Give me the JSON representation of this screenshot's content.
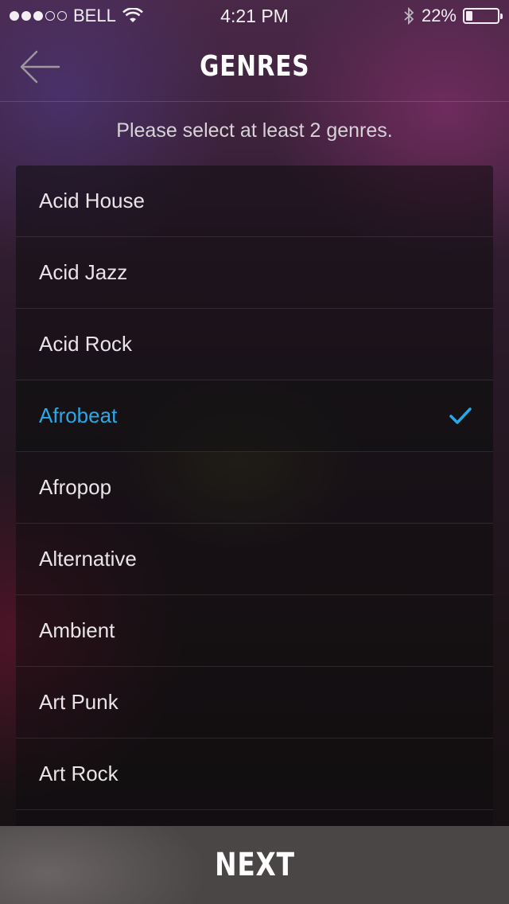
{
  "status_bar": {
    "carrier": "BELL",
    "time": "4:21 PM",
    "battery_text": "22%",
    "battery_level": 0.22,
    "signal_bars": 3,
    "signal_total": 5
  },
  "nav": {
    "title": "GENRES"
  },
  "instructions": "Please select at least 2 genres.",
  "genres": [
    {
      "label": "Acid House",
      "selected": false
    },
    {
      "label": "Acid Jazz",
      "selected": false
    },
    {
      "label": "Acid Rock",
      "selected": false
    },
    {
      "label": "Afrobeat",
      "selected": true
    },
    {
      "label": "Afropop",
      "selected": false
    },
    {
      "label": "Alternative",
      "selected": false
    },
    {
      "label": "Ambient",
      "selected": false
    },
    {
      "label": "Art Punk",
      "selected": false
    },
    {
      "label": "Art Rock",
      "selected": false
    }
  ],
  "next_label": "NEXT",
  "colors": {
    "accent": "#2aa8e6"
  }
}
